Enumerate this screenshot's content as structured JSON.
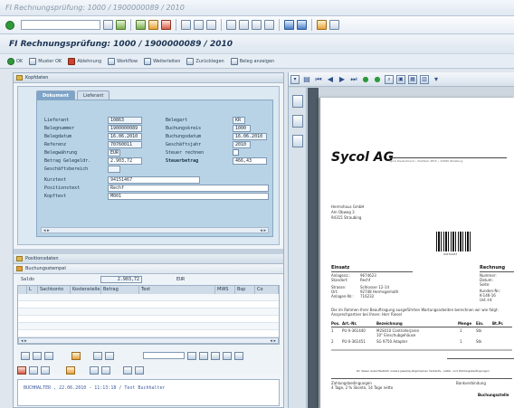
{
  "window": {
    "title": "FI Rechnungsprüfung: 1000 / 1900000089 / 2010"
  },
  "app": {
    "title": "FI Rechnungsprüfung: 1000 / 1900000089 / 2010",
    "toolbar": [
      {
        "label": "OK",
        "icon": "check-icon"
      },
      {
        "label": "Muster OK",
        "icon": "check-icon"
      },
      {
        "label": "Ablehnung",
        "icon": "reject-icon"
      },
      {
        "label": "Workflow",
        "icon": "workflow-icon"
      },
      {
        "label": "Weiterleiten",
        "icon": "forward-icon"
      },
      {
        "label": "Zurücklegen",
        "icon": "back-icon"
      },
      {
        "label": "Beleg anzeigen",
        "icon": "document-icon"
      }
    ]
  },
  "kopf": {
    "section_label": "Kopfdaten",
    "tabs": [
      "Dokument",
      "Lieferant"
    ],
    "active_tab": "Dokument",
    "left_fields": [
      {
        "label": "Lieferant",
        "value": "10863"
      },
      {
        "label": "Belegnummer",
        "value": "1900000089"
      },
      {
        "label": "Belegdatum",
        "value": "16.06.2010"
      },
      {
        "label": "Referenz",
        "value": "70760011"
      },
      {
        "label": "Belegwährung",
        "value": "EUR"
      },
      {
        "label": "Betrag Gelegeldr.",
        "value": "2.903,72"
      },
      {
        "label": "Geschäftsbereich",
        "value": ""
      }
    ],
    "right_fields": [
      {
        "label": "Belegart",
        "value": "KR"
      },
      {
        "label": "Buchungskreis",
        "value": "1000"
      },
      {
        "label": "Buchungsdatum",
        "value": "16.06.2010"
      },
      {
        "label": "Geschäftsjahr",
        "value": "2010"
      },
      {
        "label": "Steuer rechnen",
        "value": ""
      },
      {
        "label": "Steuerbetrag",
        "value": "466,43"
      }
    ],
    "bottom_fields": [
      {
        "label": "Kurztext",
        "value": "94151467"
      },
      {
        "label": "Positionstext",
        "value": "Rechf"
      },
      {
        "label": "Kopftext",
        "value": "M001"
      }
    ]
  },
  "positions": {
    "section_label": "Positionsdaten",
    "sub_label": "Buchungsstempel",
    "saldo_label": "Saldo",
    "saldo_value": "2.903,72",
    "currency": "EUR",
    "columns": [
      "L",
      "Sachkonto",
      "Kostenstelle",
      "Betrag",
      "Text",
      "MWS",
      "Bsp",
      "Co"
    ]
  },
  "note": {
    "text": "BUCHHALTER , 22.06.2010 - 11:13:18 / Text Buchhalter"
  },
  "document": {
    "company": "Sycol AG",
    "company_tagline": "Sycol Deutschland • Postfach 4815 • 97080 Würzburg",
    "recipient": [
      "Hermshaus GmbH",
      "Am Obweg 3",
      "94315 Straubing"
    ],
    "barcode_number": "94151467",
    "einsatz_label": "Einsatz",
    "einsatz_rows": [
      [
        "Anlagenz.:",
        "9674623"
      ],
      [
        "Standort:",
        "Rechf"
      ]
    ],
    "kunde_rows": [
      [
        "Strasse:",
        "Schlosser 12-14"
      ],
      [
        "Ort:",
        "92748 Hermsgemath"
      ],
      [
        "Anlagen-Nr.:",
        "716232"
      ]
    ],
    "right_header": "Rechnung",
    "right_rows": [
      "Nummer:",
      "Datum:",
      "Seite:",
      "Kunden-Nr.:",
      "K-146-16",
      "Ust.-Id:"
    ],
    "intro_text": "Die im Rahmen Ihrer Beauftragung ausgeführten Wartungsarbeiten berechnen wir wie folgt:",
    "intro_text2": "Ansprechpartner bei Ihnen: Herr Riesel",
    "table_header": [
      "Pos.",
      "Art.-Nr.",
      "Bezeichnung",
      "Menge",
      "Ein.",
      "Bt.Pr."
    ],
    "table_rows": [
      [
        "1",
        "PU-X-361440",
        "M2S010 Controllerjaren",
        "1",
        "Stk"
      ],
      [
        "",
        "",
        "10\" Einschubgehäuse",
        "",
        ""
      ],
      [
        "2",
        "PU-X-361451",
        "SG 9750 Adapter",
        "1",
        "Stk"
      ]
    ],
    "footer_text": "Zu dieser ausschließlich unsere jeweilig allgemeinen Verkaufs-, Liefer- und Zahlungsbedingungen",
    "footer_text2": "Zahlungsbedingungen",
    "footer_text3": "4 Tage, 2 % Skonto, 14 Tage netto",
    "footer_text4": "Bankverbindung",
    "footer_text5": "Buchungsstelle"
  }
}
